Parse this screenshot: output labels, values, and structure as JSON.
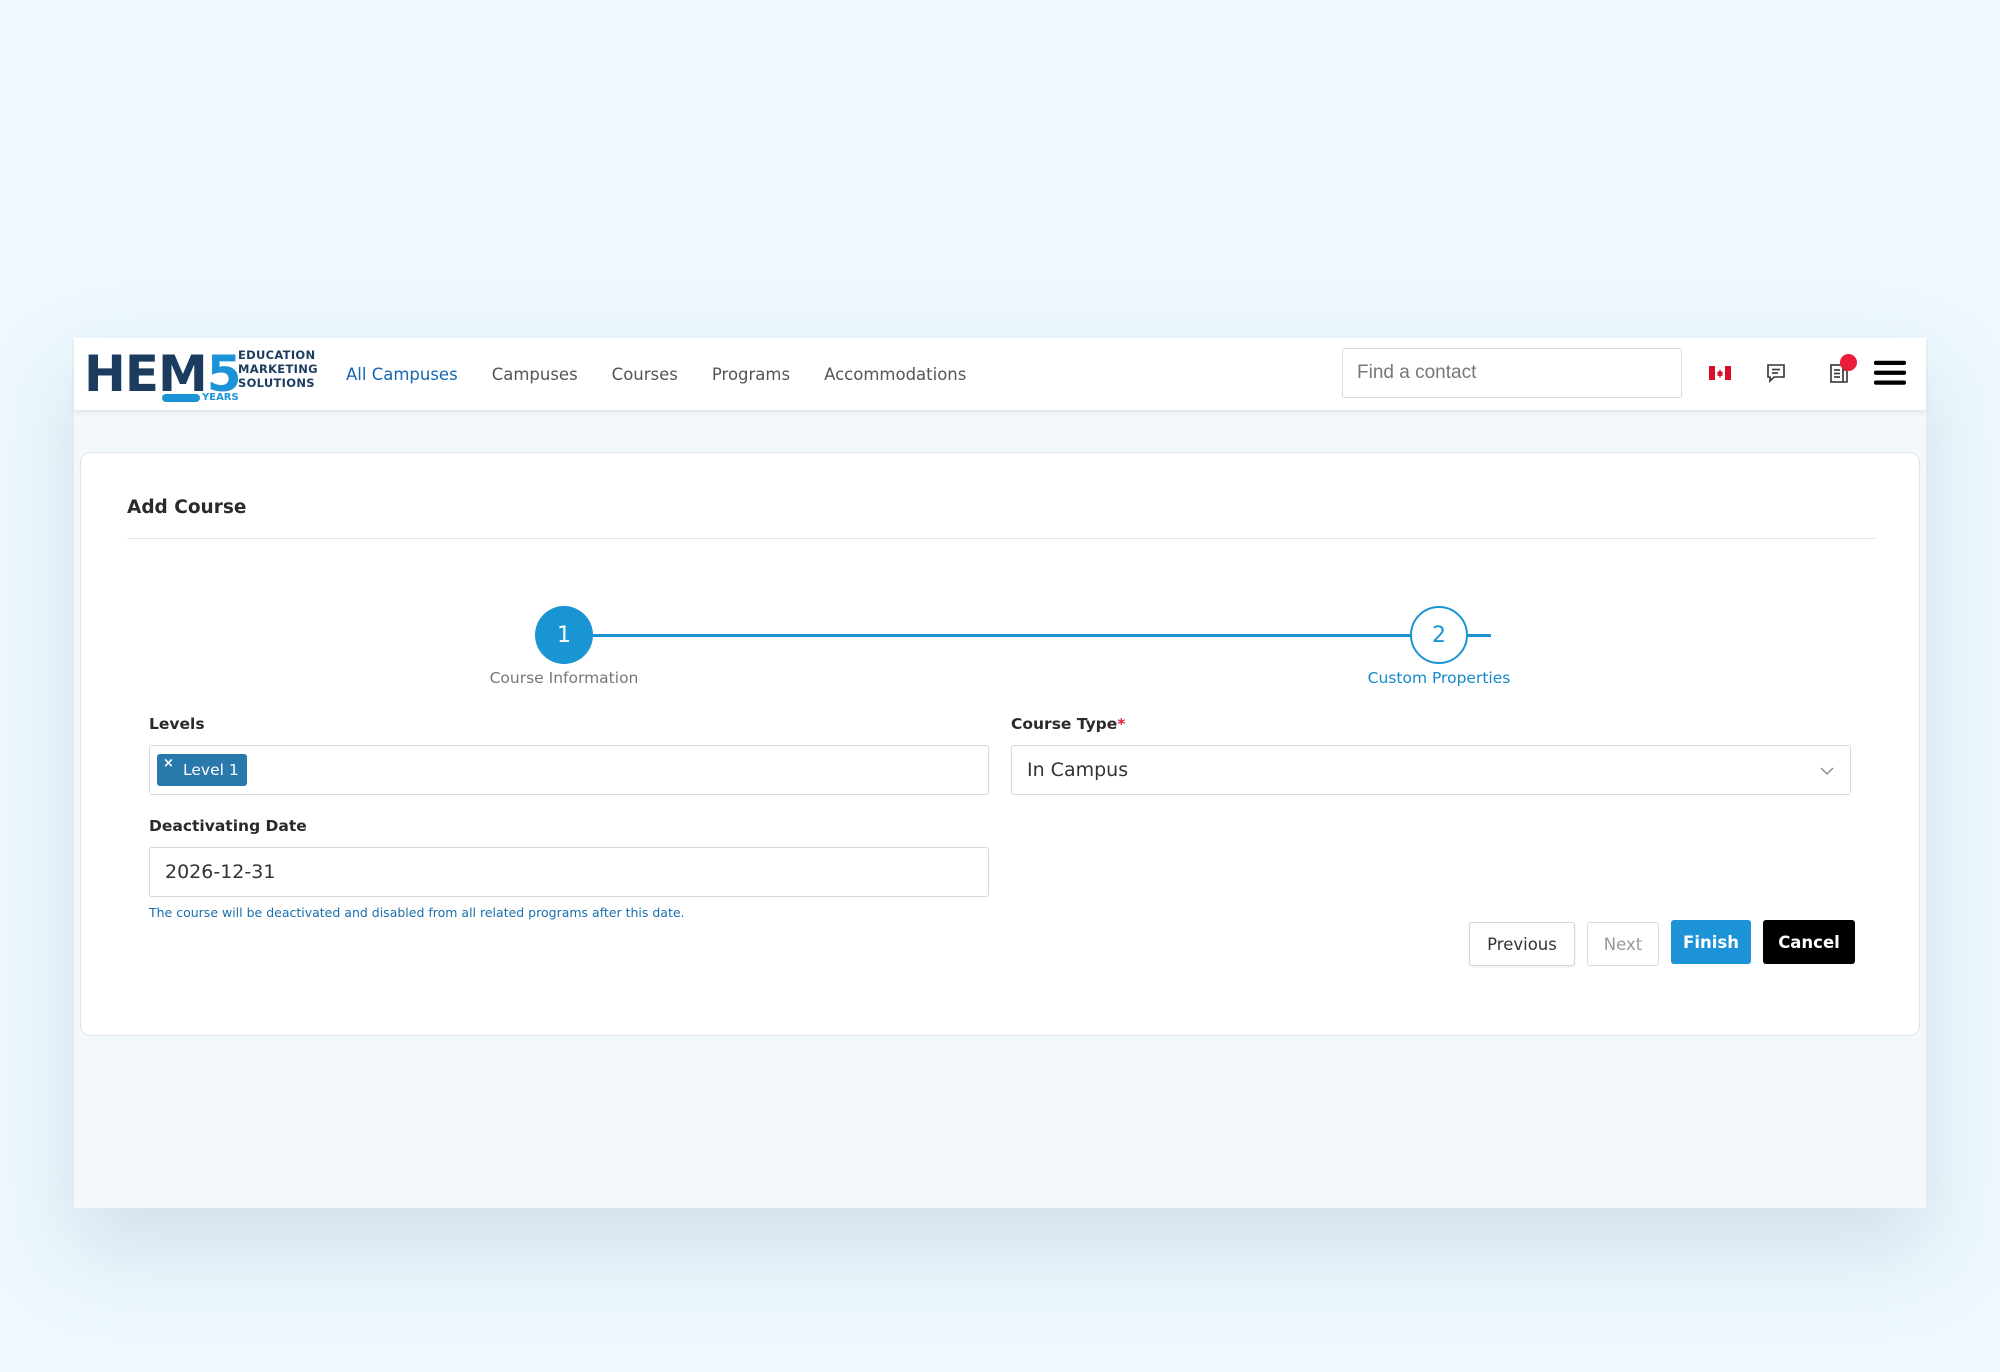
{
  "logo": {
    "main_text": "HEM",
    "main_digit": "5",
    "lines": [
      "EDUCATION",
      "MARKETING",
      "SOLUTIONS"
    ],
    "years": "YEARS"
  },
  "nav": {
    "links": [
      "All Campuses",
      "Campuses",
      "Courses",
      "Programs",
      "Accommodations"
    ],
    "search_placeholder": "Find a contact"
  },
  "icons": {
    "flag": "canada-flag-icon",
    "chat": "chat-icon",
    "news": "news-icon",
    "menu": "hamburger-menu-icon"
  },
  "colors": {
    "accent": "#1c93d6",
    "active_nav": "#1567b4",
    "notification": "#ee1c3b",
    "tag": "#2a79ad"
  },
  "card": {
    "title": "Add Course"
  },
  "stepper": {
    "steps": [
      {
        "number": "1",
        "label": "Course Information"
      },
      {
        "number": "2",
        "label": "Custom Properties"
      }
    ]
  },
  "form": {
    "levels_label": "Levels",
    "levels_tag": "Level 1",
    "course_type_label": "Course Type",
    "course_type_required": "*",
    "course_type_value": "In Campus",
    "deactivating_label": "Deactivating Date",
    "deactivating_value": "2026-12-31",
    "hint": "The course will be deactivated and disabled from all related programs after this date."
  },
  "buttons": {
    "previous": "Previous",
    "next": "Next",
    "finish": "Finish",
    "cancel": "Cancel"
  }
}
